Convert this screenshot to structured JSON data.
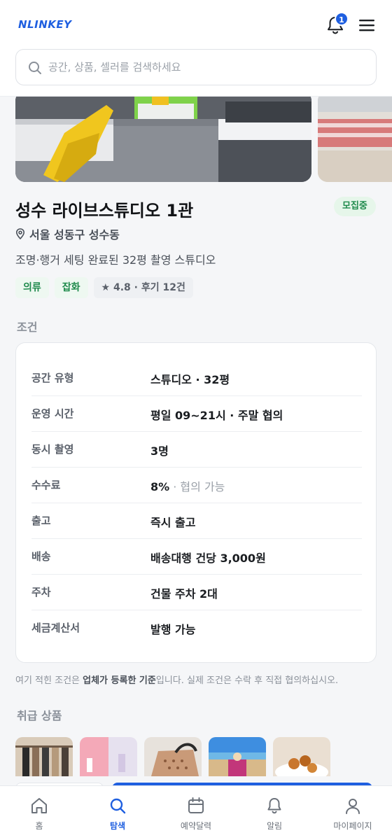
{
  "header": {
    "logo": "NLINKEY",
    "notification_count": "1",
    "search_placeholder": "공간, 상품, 셀러를 검색하세요"
  },
  "listing": {
    "title": "성수 라이브스튜디오 1관",
    "status": "모집중",
    "location": "서울 성동구 성수동",
    "description": "조명·행거 세팅 완료된 32평 촬영 스튜디오",
    "tags": [
      "의류",
      "잡화"
    ],
    "rating": "★ 4.8 · 후기 12건"
  },
  "conditions": {
    "section_title": "조건",
    "rows": [
      {
        "key": "공간 유형",
        "value": "스튜디오 · 32평",
        "extra": ""
      },
      {
        "key": "운영 시간",
        "value": "평일 09~21시 · 주말 협의",
        "extra": ""
      },
      {
        "key": "동시 촬영",
        "value": "3명",
        "extra": ""
      },
      {
        "key": "수수료",
        "value": "8%",
        "extra": " · 협의 가능"
      },
      {
        "key": "출고",
        "value": "즉시 출고",
        "extra": ""
      },
      {
        "key": "배송",
        "value": "배송대행 건당 3,000원",
        "extra": ""
      },
      {
        "key": "주차",
        "value": "건물 주차 2대",
        "extra": ""
      },
      {
        "key": "세금계산서",
        "value": "발행 가능",
        "extra": ""
      }
    ],
    "note_prefix": "여기 적힌 조건은 ",
    "note_bold": "업체가 등록한 기준",
    "note_suffix": "입니다. 실제 조건은 수락 후 직접 협의하십시오."
  },
  "products": {
    "section_title": "취급 상품"
  },
  "tabbar": {
    "items": [
      {
        "label": "홈",
        "icon": "home-icon",
        "active": false
      },
      {
        "label": "탐색",
        "icon": "search-icon",
        "active": true
      },
      {
        "label": "예약달력",
        "icon": "calendar-icon",
        "active": false
      },
      {
        "label": "알림",
        "icon": "bell-icon",
        "active": false
      },
      {
        "label": "마이페이지",
        "icon": "user-icon",
        "active": false
      }
    ]
  },
  "colors": {
    "accent": "#1f5fe0",
    "green": "#1f8a4c",
    "background": "#f5f6f8"
  }
}
